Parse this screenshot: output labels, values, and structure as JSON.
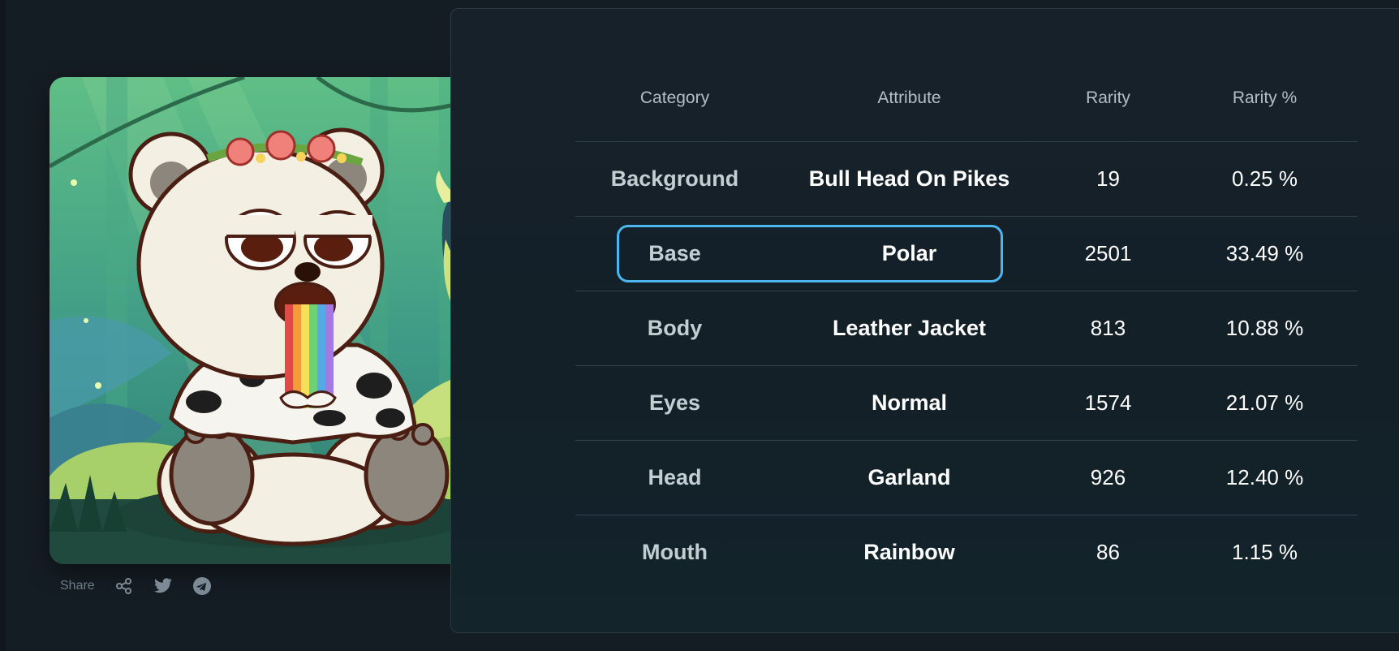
{
  "share": {
    "label": "Share",
    "icons": [
      "share-icon",
      "twitter-icon",
      "telegram-icon"
    ]
  },
  "table": {
    "headers": {
      "category": "Category",
      "attribute": "Attribute",
      "rarity": "Rarity",
      "rarity_pct": "Rarity %"
    },
    "rows": [
      {
        "category": "Background",
        "attribute": "Bull Head On Pikes",
        "rarity": "19",
        "rarity_pct": "0.25 %"
      },
      {
        "category": "Base",
        "attribute": "Polar",
        "rarity": "2501",
        "rarity_pct": "33.49 %"
      },
      {
        "category": "Body",
        "attribute": "Leather Jacket",
        "rarity": "813",
        "rarity_pct": "10.88 %"
      },
      {
        "category": "Eyes",
        "attribute": "Normal",
        "rarity": "1574",
        "rarity_pct": "21.07 %"
      },
      {
        "category": "Head",
        "attribute": "Garland",
        "rarity": "926",
        "rarity_pct": "12.40 %"
      },
      {
        "category": "Mouth",
        "attribute": "Rainbow",
        "rarity": "86",
        "rarity_pct": "1.15 %"
      }
    ],
    "highlighted_row": 1
  },
  "colors": {
    "page_bg": "#151d24",
    "panel_border": "#2b3a44",
    "highlight": "#4cb6ee",
    "header_text": "#b3bec6"
  }
}
